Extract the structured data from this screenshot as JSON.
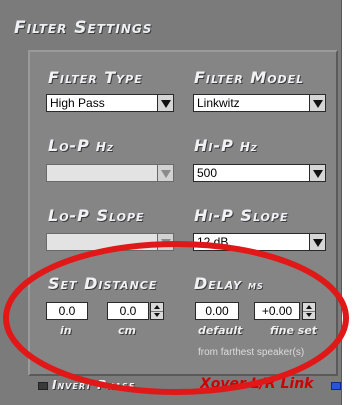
{
  "header": {
    "title": "Filter Settings"
  },
  "filter_type": {
    "label": "Filter Type",
    "value": "High Pass"
  },
  "filter_model": {
    "label": "Filter Model",
    "value": "Linkwitz"
  },
  "lo_p": {
    "label": "Lo-P",
    "unit": "Hz",
    "value": ""
  },
  "hi_p": {
    "label": "Hi-P",
    "unit": "Hz",
    "value": "500"
  },
  "lo_p_slope": {
    "label": "Lo-P Slope",
    "value": ""
  },
  "hi_p_slope": {
    "label": "Hi-P Slope",
    "value": "12 dB"
  },
  "distance": {
    "label": "Set Distance",
    "in_value": "0.0",
    "cm_value": "0.0",
    "in_label": "in",
    "cm_label": "cm"
  },
  "delay": {
    "label": "Delay",
    "unit": "ms",
    "default_value": "0.00",
    "fine_value": "+0.00",
    "default_label": "default",
    "fine_label": "fine set",
    "note": "from farthest speaker(s)"
  },
  "bottom": {
    "invert_phase": "Invert Phase",
    "xover_link": "Xover L/R Link"
  },
  "colors": {
    "annotation": "#e01818",
    "panel": "#858585",
    "link_led": "#2b55d8"
  }
}
